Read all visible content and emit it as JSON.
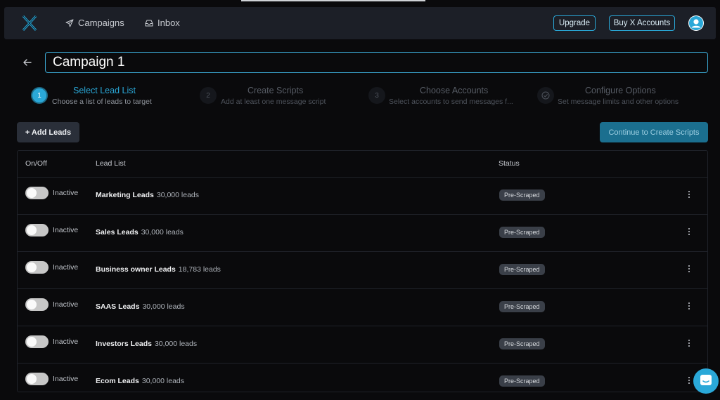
{
  "nav": {
    "links": [
      {
        "label": "Campaigns",
        "icon": "send-icon"
      },
      {
        "label": "Inbox",
        "icon": "inbox-icon"
      }
    ],
    "upgrade_label": "Upgrade",
    "buy_label": "Buy X Accounts"
  },
  "campaign": {
    "name": "Campaign 1"
  },
  "steps": [
    {
      "number": "1",
      "title": "Select Lead List",
      "subtitle": "Choose a list of leads to target",
      "active": true
    },
    {
      "number": "2",
      "title": "Create Scripts",
      "subtitle": "Add at least one message script",
      "active": false
    },
    {
      "number": "3",
      "title": "Choose Accounts",
      "subtitle": "Select accounts to send messages f...",
      "active": false
    },
    {
      "number": "",
      "title": "Configure Options",
      "subtitle": "Set message limits and other options",
      "active": false,
      "icon": "check-circle-icon"
    }
  ],
  "actions": {
    "add_leads": "+ Add Leads",
    "continue": "Continue to Create Scripts"
  },
  "table": {
    "headers": [
      "On/Off",
      "Lead List",
      "Status"
    ],
    "rows": [
      {
        "toggle": "Inactive",
        "name": "Marketing Leads",
        "count": "30,000 leads",
        "status": "Pre-Scraped"
      },
      {
        "toggle": "Inactive",
        "name": "Sales Leads",
        "count": "30,000 leads",
        "status": "Pre-Scraped"
      },
      {
        "toggle": "Inactive",
        "name": "Business owner Leads",
        "count": "18,783 leads",
        "status": "Pre-Scraped"
      },
      {
        "toggle": "Inactive",
        "name": "SAAS Leads",
        "count": "30,000 leads",
        "status": "Pre-Scraped"
      },
      {
        "toggle": "Inactive",
        "name": "Investors Leads",
        "count": "30,000 leads",
        "status": "Pre-Scraped"
      },
      {
        "toggle": "Inactive",
        "name": "Ecom Leads",
        "count": "30,000 leads",
        "status": "Pre-Scraped"
      }
    ]
  },
  "colors": {
    "accent": "#2aa8d8",
    "background": "#0a0a0c",
    "navbar": "#1c1f27"
  }
}
